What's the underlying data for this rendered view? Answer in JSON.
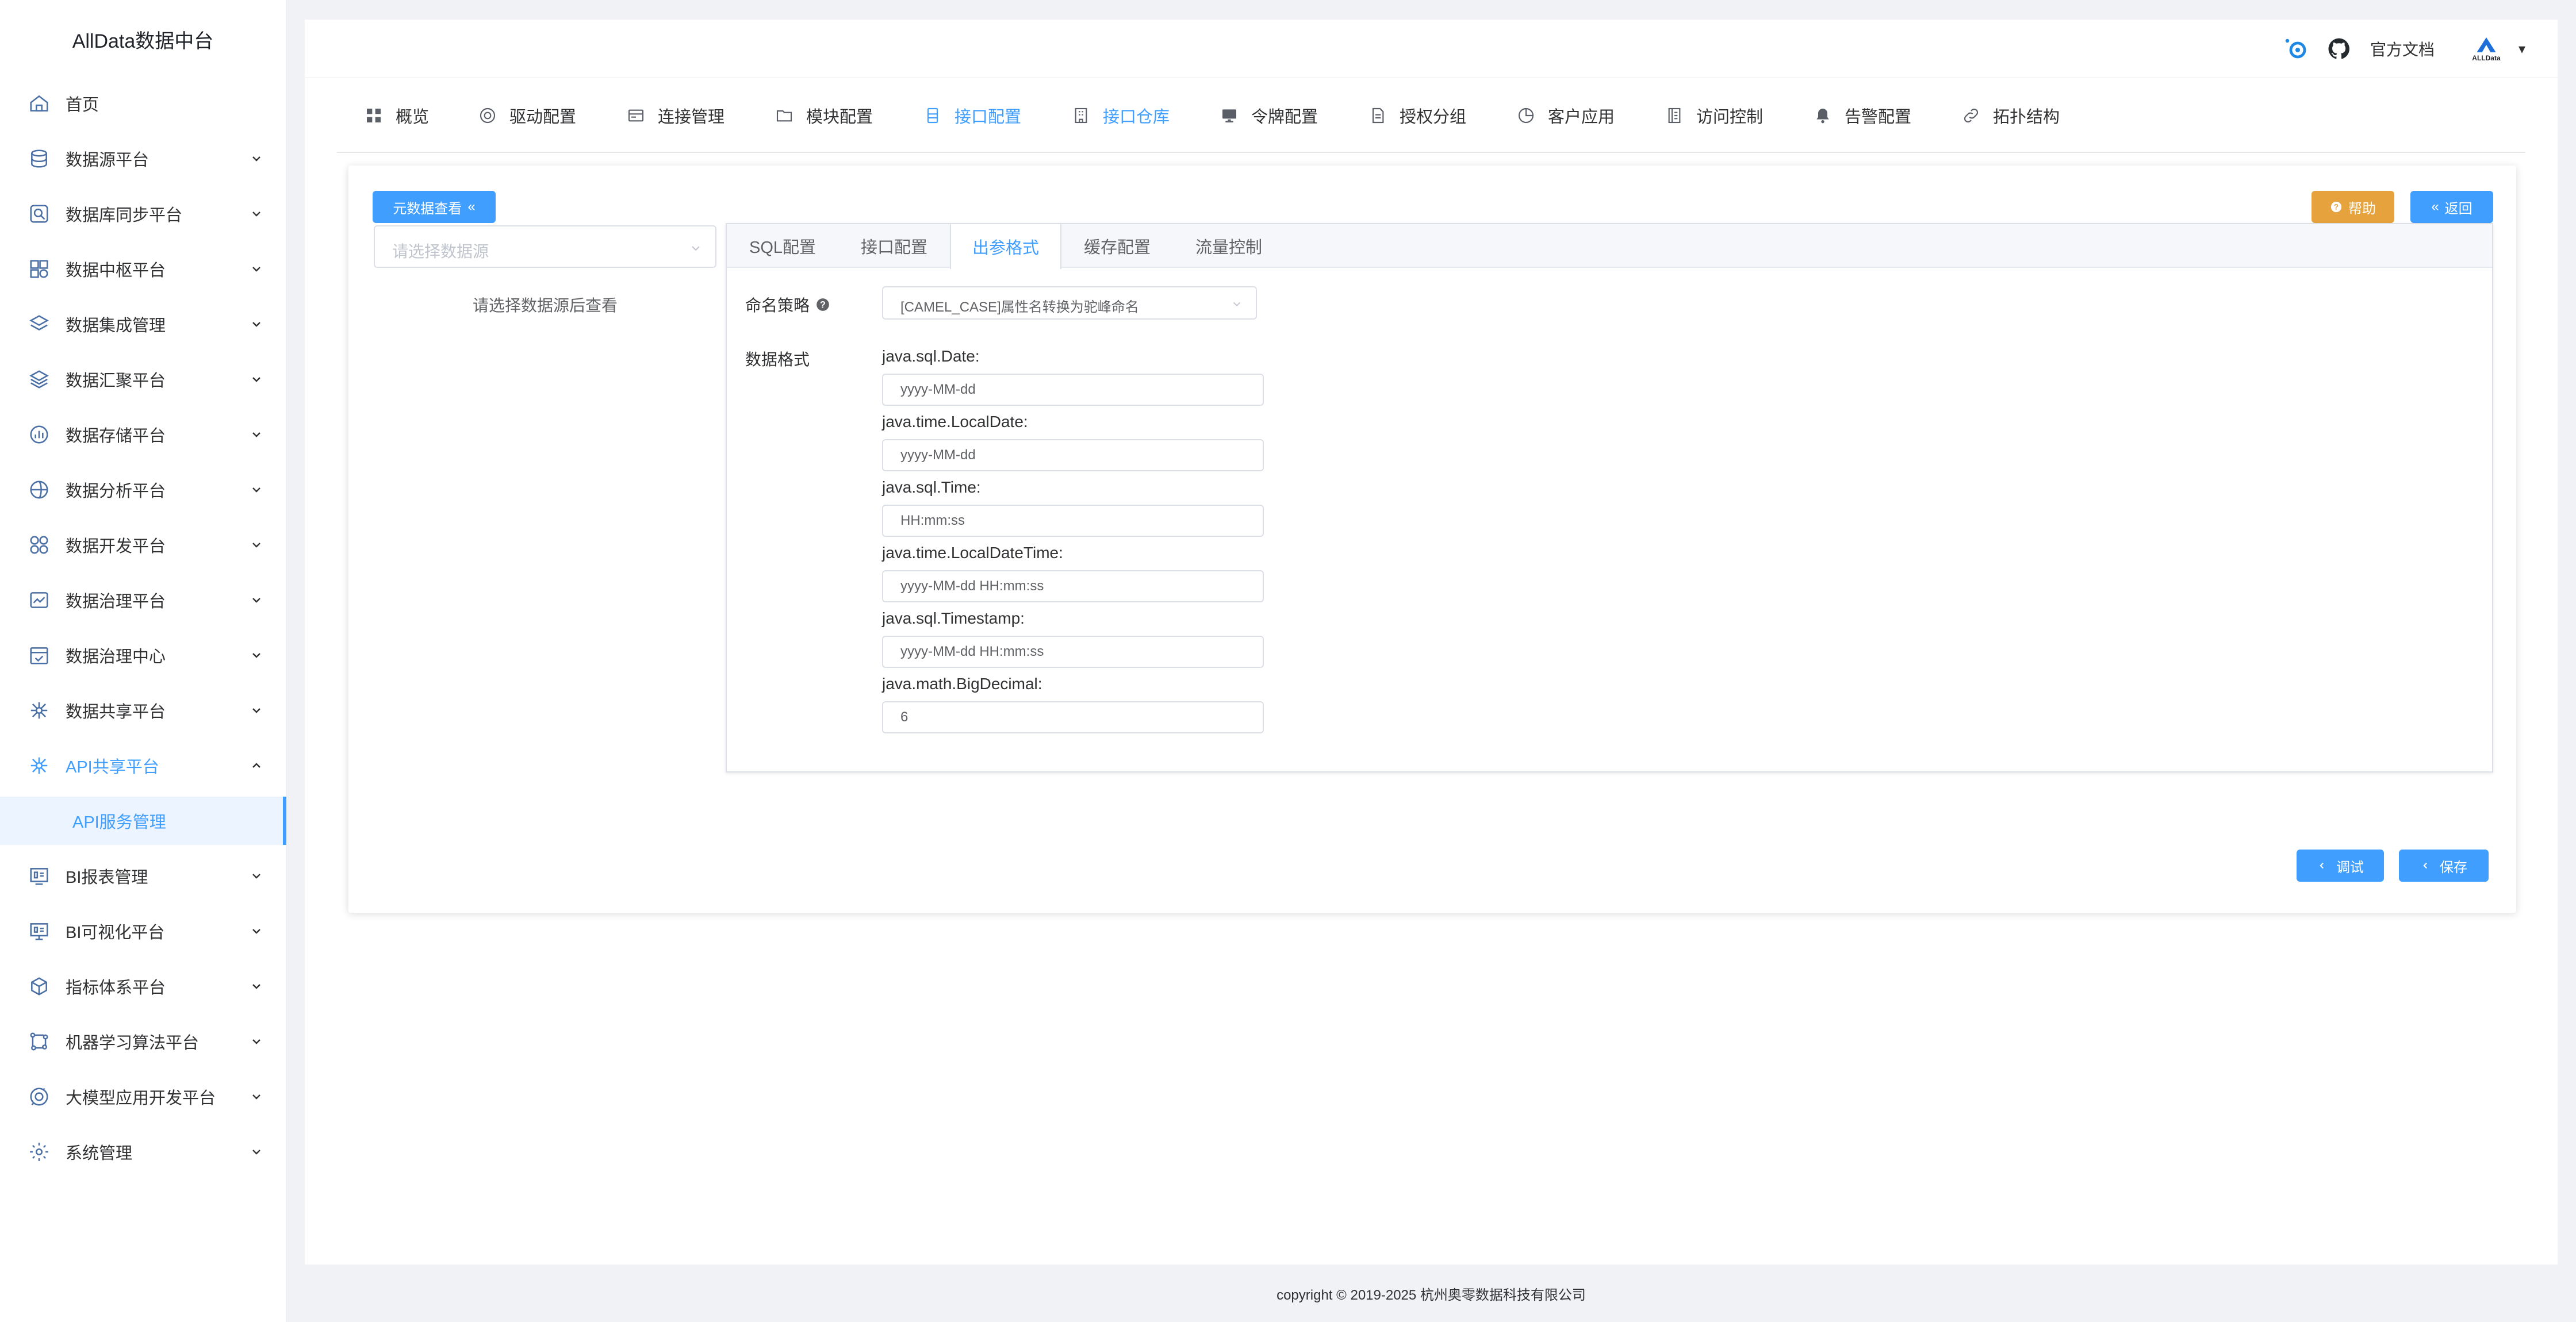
{
  "app": {
    "title": "AllData数据中台"
  },
  "sidebar": {
    "items": [
      {
        "label": "首页",
        "icon": "home-icon"
      },
      {
        "label": "数据源平台",
        "icon": "database-icon"
      },
      {
        "label": "数据库同步平台",
        "icon": "sync-icon"
      },
      {
        "label": "数据中枢平台",
        "icon": "hub-icon"
      },
      {
        "label": "数据集成管理",
        "icon": "layers-icon"
      },
      {
        "label": "数据汇聚平台",
        "icon": "stack-icon"
      },
      {
        "label": "数据存储平台",
        "icon": "storage-icon"
      },
      {
        "label": "数据分析平台",
        "icon": "analysis-icon"
      },
      {
        "label": "数据开发平台",
        "icon": "dev-icon"
      },
      {
        "label": "数据治理平台",
        "icon": "governance-icon"
      },
      {
        "label": "数据治理中心",
        "icon": "calendar-check-icon"
      },
      {
        "label": "数据共享平台",
        "icon": "share-icon"
      },
      {
        "label": "API共享平台",
        "icon": "api-icon"
      },
      {
        "label": "BI报表管理",
        "icon": "bi-report-icon"
      },
      {
        "label": "BI可视化平台",
        "icon": "bi-screen-icon"
      },
      {
        "label": "指标体系平台",
        "icon": "cube-icon"
      },
      {
        "label": "机器学习算法平台",
        "icon": "ml-icon"
      },
      {
        "label": "大模型应用开发平台",
        "icon": "llm-icon"
      },
      {
        "label": "系统管理",
        "icon": "settings-icon"
      }
    ],
    "sub_item": "API服务管理"
  },
  "header": {
    "docs": "官方文档",
    "avatar_text": "ALLData",
    "dropdown": "▾"
  },
  "topnav": {
    "items": [
      {
        "label": "概览",
        "icon": "grid-icon"
      },
      {
        "label": "驱动配置",
        "icon": "driver-icon"
      },
      {
        "label": "连接管理",
        "icon": "connection-icon"
      },
      {
        "label": "模块配置",
        "icon": "folder-icon"
      },
      {
        "label": "接口配置",
        "icon": "interface-icon"
      },
      {
        "label": "接口仓库",
        "icon": "warehouse-icon"
      },
      {
        "label": "令牌配置",
        "icon": "monitor-icon"
      },
      {
        "label": "授权分组",
        "icon": "document-icon"
      },
      {
        "label": "客户应用",
        "icon": "pie-icon"
      },
      {
        "label": "访问控制",
        "icon": "list-icon"
      },
      {
        "label": "告警配置",
        "icon": "bell-icon"
      },
      {
        "label": "拓扑结构",
        "icon": "link-icon"
      }
    ]
  },
  "toolbar": {
    "meta_view": "元数据查看",
    "meta_view_icon": "«",
    "help": "帮助",
    "back": "返回",
    "back_icon": "«",
    "debug": "调试",
    "save": "保存"
  },
  "datasource": {
    "placeholder": "请选择数据源",
    "hint": "请选择数据源后查看"
  },
  "tabs": [
    "SQL配置",
    "接口配置",
    "出参格式",
    "缓存配置",
    "流量控制"
  ],
  "form": {
    "naming_label": "命名策略",
    "naming_value": "[CAMEL_CASE]属性名转换为驼峰命名",
    "format_label": "数据格式",
    "fields": [
      {
        "label": "java.sql.Date:",
        "value": "yyyy-MM-dd"
      },
      {
        "label": "java.time.LocalDate:",
        "value": "yyyy-MM-dd"
      },
      {
        "label": "java.sql.Time:",
        "value": "HH:mm:ss"
      },
      {
        "label": "java.time.LocalDateTime:",
        "value": "yyyy-MM-dd HH:mm:ss"
      },
      {
        "label": "java.sql.Timestamp:",
        "value": "yyyy-MM-dd HH:mm:ss"
      },
      {
        "label": "java.math.BigDecimal:",
        "value": "6"
      }
    ]
  },
  "footer": {
    "copyright": "copyright © 2019-2025 杭州奥零数据科技有限公司"
  },
  "colors": {
    "accent": "#409eff",
    "help": "#e6a23c",
    "text": "#303133"
  }
}
